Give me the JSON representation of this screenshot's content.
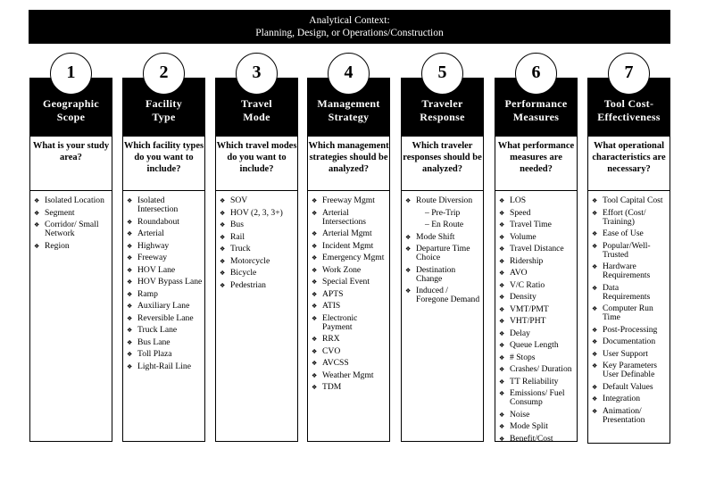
{
  "banner": {
    "line1": "Analytical Context:",
    "line2": "Planning, Design, or Operations/Construction"
  },
  "columns": [
    {
      "number": "1",
      "title_line1": "Geographic",
      "title_line2": "Scope",
      "question": "What is your study area?",
      "items": [
        {
          "text": "Isolated Location"
        },
        {
          "text": "Segment"
        },
        {
          "text": "Corridor/ Small Network"
        },
        {
          "text": "Region"
        }
      ]
    },
    {
      "number": "2",
      "title_line1": "Facility",
      "title_line2": "Type",
      "question": "Which facility types do you want to include?",
      "items": [
        {
          "text": "Isolated Intersection"
        },
        {
          "text": "Roundabout"
        },
        {
          "text": "Arterial"
        },
        {
          "text": "Highway"
        },
        {
          "text": "Freeway"
        },
        {
          "text": "HOV Lane"
        },
        {
          "text": "HOV Bypass Lane"
        },
        {
          "text": "Ramp"
        },
        {
          "text": "Auxiliary Lane"
        },
        {
          "text": "Reversible Lane"
        },
        {
          "text": "Truck Lane"
        },
        {
          "text": "Bus Lane"
        },
        {
          "text": "Toll Plaza"
        },
        {
          "text": "Light-Rail Line"
        }
      ]
    },
    {
      "number": "3",
      "title_line1": "Travel",
      "title_line2": "Mode",
      "question": "Which travel modes do you want to include?",
      "items": [
        {
          "text": "SOV"
        },
        {
          "text": "HOV (2, 3, 3+)"
        },
        {
          "text": "Bus"
        },
        {
          "text": "Rail"
        },
        {
          "text": "Truck"
        },
        {
          "text": "Motorcycle"
        },
        {
          "text": "Bicycle"
        },
        {
          "text": "Pedestrian"
        }
      ]
    },
    {
      "number": "4",
      "title_line1": "Management",
      "title_line2": "Strategy",
      "question": "Which management strategies should be analyzed?",
      "items": [
        {
          "text": "Freeway Mgmt"
        },
        {
          "text": "Arterial Intersections"
        },
        {
          "text": "Arterial Mgmt"
        },
        {
          "text": "Incident Mgmt"
        },
        {
          "text": "Emergency Mgmt"
        },
        {
          "text": "Work Zone"
        },
        {
          "text": "Special Event"
        },
        {
          "text": "APTS"
        },
        {
          "text": "ATIS"
        },
        {
          "text": "Electronic Payment"
        },
        {
          "text": "RRX"
        },
        {
          "text": "CVO"
        },
        {
          "text": "AVCSS"
        },
        {
          "text": "Weather Mgmt"
        },
        {
          "text": "TDM"
        }
      ]
    },
    {
      "number": "5",
      "title_line1": "Traveler",
      "title_line2": "Response",
      "question": "Which traveler responses should be analyzed?",
      "items": [
        {
          "text": "Route Diversion"
        },
        {
          "text": "– Pre-Trip",
          "sub": true
        },
        {
          "text": "– En Route",
          "sub": true
        },
        {
          "text": "Mode Shift"
        },
        {
          "text": "Departure Time Choice"
        },
        {
          "text": "Destination Change"
        },
        {
          "text": "Induced / Foregone Demand"
        }
      ]
    },
    {
      "number": "6",
      "title_line1": "Performance",
      "title_line2": "Measures",
      "question": "What performance measures are needed?",
      "items": [
        {
          "text": "LOS"
        },
        {
          "text": "Speed"
        },
        {
          "text": "Travel Time"
        },
        {
          "text": "Volume"
        },
        {
          "text": "Travel Distance"
        },
        {
          "text": "Ridership"
        },
        {
          "text": "AVO"
        },
        {
          "text": "V/C Ratio"
        },
        {
          "text": "Density"
        },
        {
          "text": "VMT/PMT"
        },
        {
          "text": "VHT/PHT"
        },
        {
          "text": "Delay"
        },
        {
          "text": "Queue Length"
        },
        {
          "text": "# Stops"
        },
        {
          "text": "Crashes/ Duration"
        },
        {
          "text": "TT Reliability"
        },
        {
          "text": "Emissions/ Fuel Consump"
        },
        {
          "text": "Noise"
        },
        {
          "text": "Mode Split"
        },
        {
          "text": "Benefit/Cost"
        }
      ]
    },
    {
      "number": "7",
      "title_line1": "Tool Cost-",
      "title_line2": "Effectiveness",
      "question": "What operational characteristics are necessary?",
      "items": [
        {
          "text": "Tool Capital Cost"
        },
        {
          "text": "Effort (Cost/ Training)"
        },
        {
          "text": "Ease of Use"
        },
        {
          "text": "Popular/Well-Trusted"
        },
        {
          "text": "Hardware Requirements"
        },
        {
          "text": "Data Requirements"
        },
        {
          "text": "Computer Run Time"
        },
        {
          "text": "Post-Processing"
        },
        {
          "text": "Documentation"
        },
        {
          "text": "User Support"
        },
        {
          "text": "Key Parameters User Definable"
        },
        {
          "text": "Default Values"
        },
        {
          "text": "Integration"
        },
        {
          "text": "Animation/ Presentation"
        }
      ]
    }
  ],
  "icons": {
    "bullet": "❖"
  }
}
